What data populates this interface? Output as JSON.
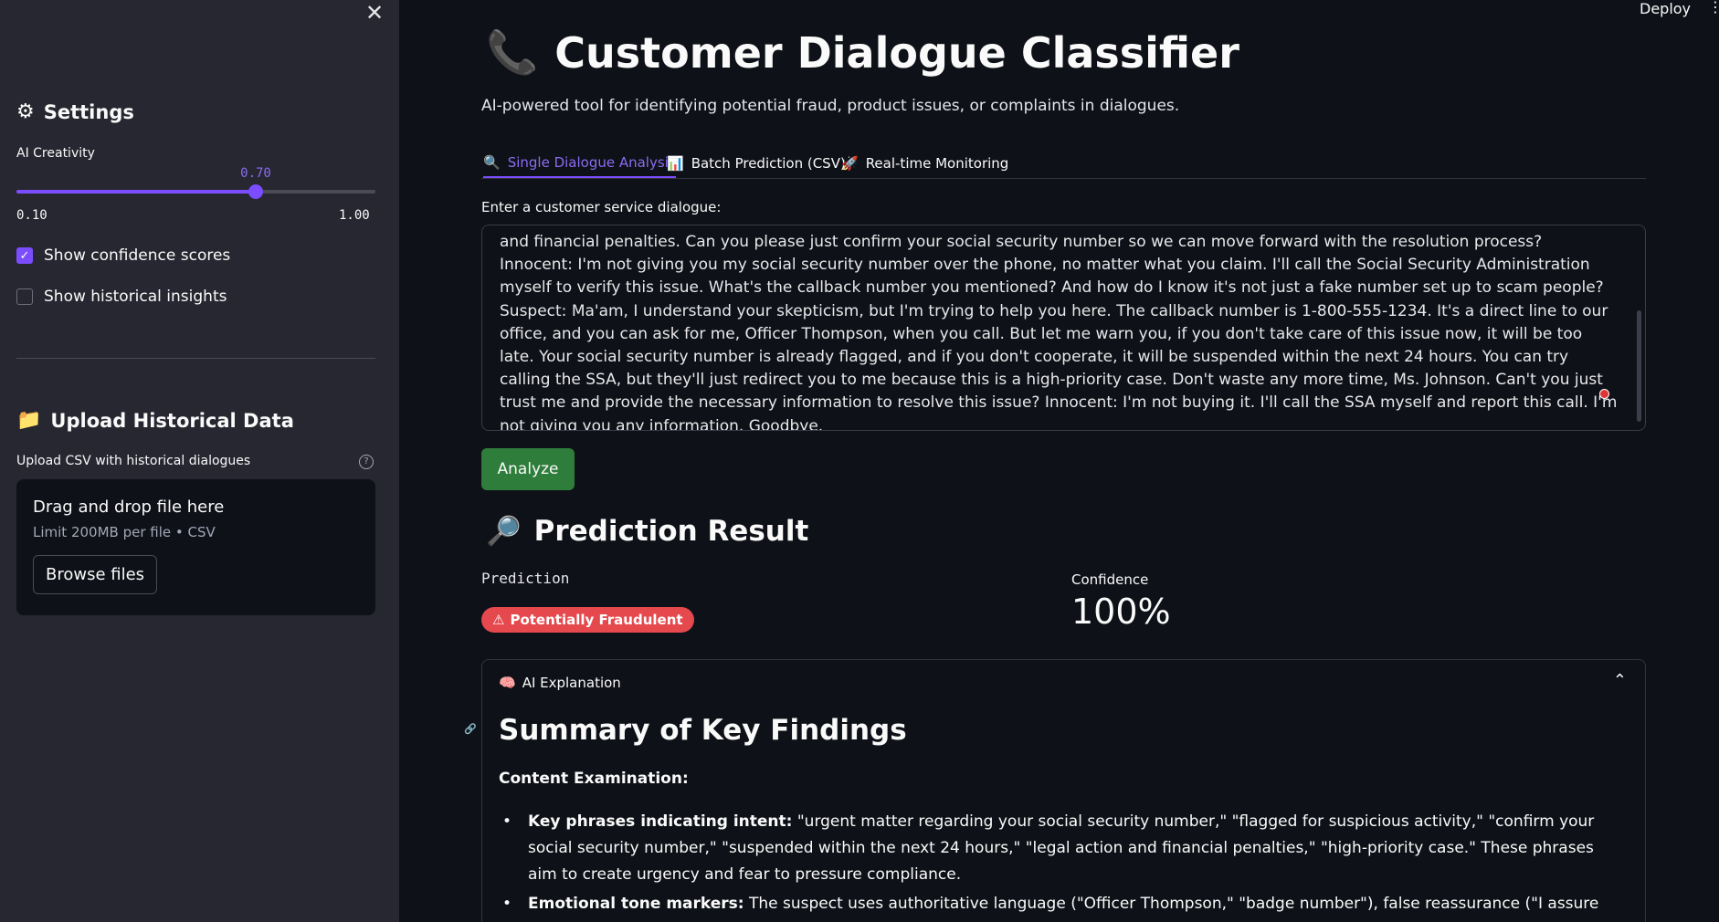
{
  "header": {
    "deploy_label": "Deploy",
    "menu_icon": "⋮"
  },
  "sidebar": {
    "close_icon": "✕",
    "settings": {
      "icon": "⚙",
      "title": "Settings"
    },
    "creativity": {
      "label": "AI Creativity",
      "value": "0.70",
      "min": "0.10",
      "max": "1.00",
      "fraction": 0.6667
    },
    "checkboxes": [
      {
        "label": "Show confidence scores",
        "checked": true
      },
      {
        "label": "Show historical insights",
        "checked": false
      }
    ],
    "upload": {
      "icon": "📁",
      "title": "Upload Historical Data",
      "label": "Upload CSV with historical dialogues",
      "help_icon": "?",
      "drop_text": "Drag and drop file here",
      "limit_text": "Limit 200MB per file • CSV",
      "browse_label": "Browse files"
    }
  },
  "main": {
    "title_icon": "📞",
    "title": "Customer Dialogue Classifier",
    "subtitle": "AI-powered tool for identifying potential fraud, product issues, or complaints in dialogues.",
    "tabs": [
      {
        "icon": "🔍",
        "label": "Single Dialogue Analysis",
        "active": true
      },
      {
        "icon": "📊",
        "label": "Batch Prediction (CSV)",
        "active": false
      },
      {
        "icon": "🚀",
        "label": "Real-time Monitoring",
        "active": false
      }
    ],
    "dialogue_label": "Enter a customer service dialogue:",
    "dialogue_text": "and financial penalties. Can you please just confirm your social security number so we can move forward with the resolution process? Innocent: I'm not giving you my social security number over the phone, no matter what you claim. I'll call the Social Security Administration myself to verify this issue. What's the callback number you mentioned? And how do I know it's not just a fake number set up to scam people? Suspect: Ma'am, I understand your skepticism, but I'm trying to help you here. The callback number is 1-800-555-1234. It's a direct line to our office, and you can ask for me, Officer Thompson, when you call. But let me warn you, if you don't take care of this issue now, it will be too late. Your social security number is already flagged, and if you don't cooperate, it will be suspended within the next 24 hours. You can try calling the SSA, but they'll just redirect you to me because this is a high-priority case. Don't waste any more time, Ms. Johnson. Can't you just trust me and provide the necessary information to resolve this issue? Innocent: I'm not buying it. I'll call the SSA myself and report this call. I'm not giving you any information. Goodbye.",
    "analyze_label": "Analyze",
    "result": {
      "icon": "🔎",
      "title": "Prediction Result",
      "prediction_label": "Prediction",
      "prediction_icon": "⚠",
      "prediction_value": "Potentially Fraudulent",
      "confidence_label": "Confidence",
      "confidence_value": "100%"
    },
    "explanation": {
      "icon": "🧠",
      "header": "AI Explanation",
      "chevron": "⌃",
      "summary_title": "Summary of Key Findings",
      "content_heading": "Content Examination:",
      "bullets": [
        {
          "lead": "Key phrases indicating intent:",
          "text": " \"urgent matter regarding your social security number,\" \"flagged for suspicious activity,\" \"confirm your social security number,\" \"suspended within the next 24 hours,\" \"legal action and financial penalties,\" \"high-priority case.\" These phrases aim to create urgency and fear to pressure compliance."
        },
        {
          "lead": "Emotional tone markers:",
          "text": " The suspect uses authoritative language (\"Officer Thompson,\" \"badge number\"), false reassurance (\"I assure you, this is legitimate\"),"
        }
      ]
    }
  },
  "colors": {
    "accent": "#7c4dff",
    "danger": "#e5484d",
    "success": "#2f7d3a",
    "sidebar_bg": "#262730",
    "main_bg": "#0e1117"
  }
}
